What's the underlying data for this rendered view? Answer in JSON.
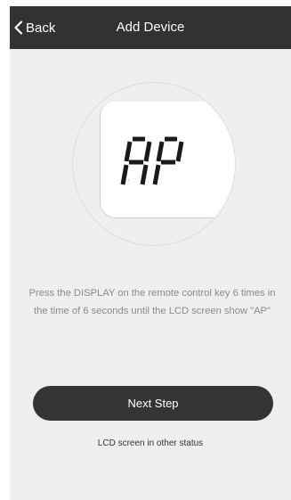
{
  "navbar": {
    "back_label": "Back",
    "title": "Add Device",
    "back_icon": "chevron-left-icon"
  },
  "display": {
    "lcd_text": "AP"
  },
  "instruction": {
    "line1": "Press the DISPLAY on the remote control key 6 times in",
    "line2": "the time of 6 seconds until the LCD screen show \"AP\""
  },
  "actions": {
    "next_step_label": "Next Step",
    "other_status_label": "LCD screen in other status"
  },
  "colors": {
    "navbar_bg": "#323232",
    "screen_bg": "#efefef",
    "button_bg": "#343434",
    "instruction_text": "#8a8a8a"
  }
}
